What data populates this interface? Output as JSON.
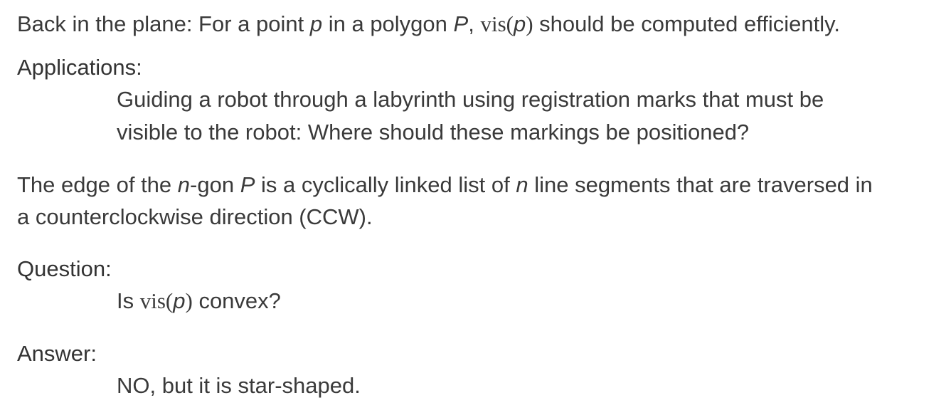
{
  "intro": {
    "text_a": "Back in the plane: For a point ",
    "var_p": "p",
    "text_b": " in a polygon ",
    "var_P": "P",
    "text_c": ", ",
    "fn_vis": "vis",
    "paren_open": "(",
    "var_p2": "p",
    "paren_close": ")",
    "text_d": " should be computed efficiently."
  },
  "applications": {
    "heading": "Applications:",
    "line1": "Guiding a robot through a labyrinth using registration marks that must be",
    "line2": "visible to the robot: Where should these markings be positioned?"
  },
  "edge": {
    "text_a": "The edge of the ",
    "var_n": "n",
    "text_b": "-gon ",
    "var_P": "P",
    "text_c": " is a cyclically linked list of ",
    "var_n2": "n",
    "text_d": " line segments that are traversed in",
    "line2": "a counterclockwise direction (CCW)."
  },
  "question": {
    "heading": "Question:",
    "text_a": "Is ",
    "fn_vis": "vis",
    "paren_open": "(",
    "var_p": "p",
    "paren_close": ")",
    "text_b": " convex?"
  },
  "answer": {
    "heading": "Answer:",
    "text": "NO, but it is star-shaped."
  }
}
